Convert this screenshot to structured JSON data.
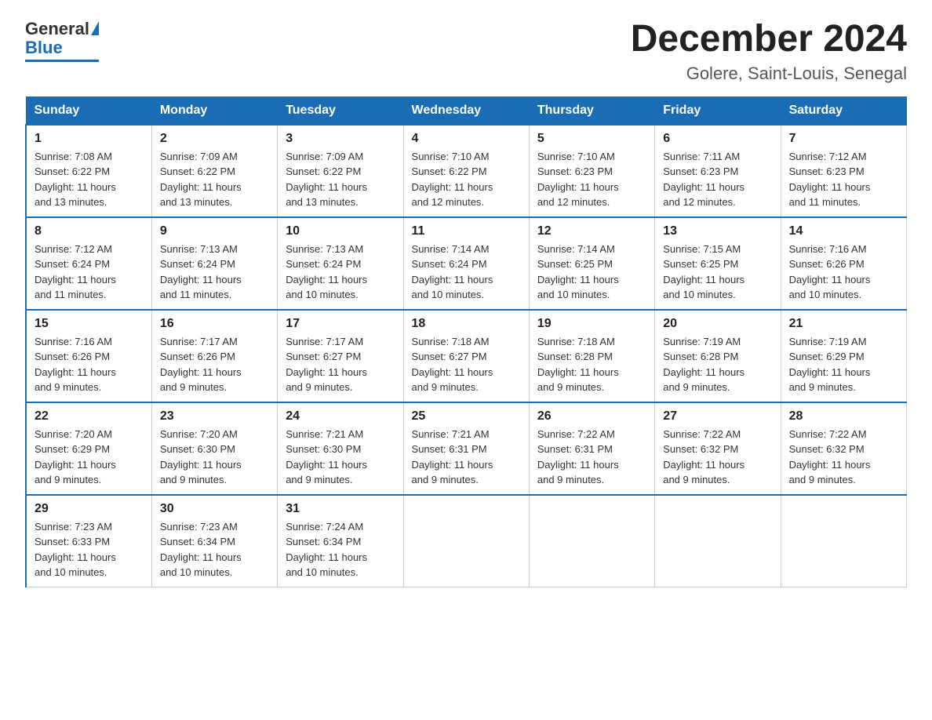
{
  "header": {
    "logo": {
      "general": "General",
      "blue": "Blue"
    },
    "title": "December 2024",
    "location": "Golere, Saint-Louis, Senegal"
  },
  "days_of_week": [
    "Sunday",
    "Monday",
    "Tuesday",
    "Wednesday",
    "Thursday",
    "Friday",
    "Saturday"
  ],
  "weeks": [
    [
      {
        "day": "1",
        "sunrise": "7:08 AM",
        "sunset": "6:22 PM",
        "daylight": "11 hours and 13 minutes."
      },
      {
        "day": "2",
        "sunrise": "7:09 AM",
        "sunset": "6:22 PM",
        "daylight": "11 hours and 13 minutes."
      },
      {
        "day": "3",
        "sunrise": "7:09 AM",
        "sunset": "6:22 PM",
        "daylight": "11 hours and 13 minutes."
      },
      {
        "day": "4",
        "sunrise": "7:10 AM",
        "sunset": "6:22 PM",
        "daylight": "11 hours and 12 minutes."
      },
      {
        "day": "5",
        "sunrise": "7:10 AM",
        "sunset": "6:23 PM",
        "daylight": "11 hours and 12 minutes."
      },
      {
        "day": "6",
        "sunrise": "7:11 AM",
        "sunset": "6:23 PM",
        "daylight": "11 hours and 12 minutes."
      },
      {
        "day": "7",
        "sunrise": "7:12 AM",
        "sunset": "6:23 PM",
        "daylight": "11 hours and 11 minutes."
      }
    ],
    [
      {
        "day": "8",
        "sunrise": "7:12 AM",
        "sunset": "6:24 PM",
        "daylight": "11 hours and 11 minutes."
      },
      {
        "day": "9",
        "sunrise": "7:13 AM",
        "sunset": "6:24 PM",
        "daylight": "11 hours and 11 minutes."
      },
      {
        "day": "10",
        "sunrise": "7:13 AM",
        "sunset": "6:24 PM",
        "daylight": "11 hours and 10 minutes."
      },
      {
        "day": "11",
        "sunrise": "7:14 AM",
        "sunset": "6:24 PM",
        "daylight": "11 hours and 10 minutes."
      },
      {
        "day": "12",
        "sunrise": "7:14 AM",
        "sunset": "6:25 PM",
        "daylight": "11 hours and 10 minutes."
      },
      {
        "day": "13",
        "sunrise": "7:15 AM",
        "sunset": "6:25 PM",
        "daylight": "11 hours and 10 minutes."
      },
      {
        "day": "14",
        "sunrise": "7:16 AM",
        "sunset": "6:26 PM",
        "daylight": "11 hours and 10 minutes."
      }
    ],
    [
      {
        "day": "15",
        "sunrise": "7:16 AM",
        "sunset": "6:26 PM",
        "daylight": "11 hours and 9 minutes."
      },
      {
        "day": "16",
        "sunrise": "7:17 AM",
        "sunset": "6:26 PM",
        "daylight": "11 hours and 9 minutes."
      },
      {
        "day": "17",
        "sunrise": "7:17 AM",
        "sunset": "6:27 PM",
        "daylight": "11 hours and 9 minutes."
      },
      {
        "day": "18",
        "sunrise": "7:18 AM",
        "sunset": "6:27 PM",
        "daylight": "11 hours and 9 minutes."
      },
      {
        "day": "19",
        "sunrise": "7:18 AM",
        "sunset": "6:28 PM",
        "daylight": "11 hours and 9 minutes."
      },
      {
        "day": "20",
        "sunrise": "7:19 AM",
        "sunset": "6:28 PM",
        "daylight": "11 hours and 9 minutes."
      },
      {
        "day": "21",
        "sunrise": "7:19 AM",
        "sunset": "6:29 PM",
        "daylight": "11 hours and 9 minutes."
      }
    ],
    [
      {
        "day": "22",
        "sunrise": "7:20 AM",
        "sunset": "6:29 PM",
        "daylight": "11 hours and 9 minutes."
      },
      {
        "day": "23",
        "sunrise": "7:20 AM",
        "sunset": "6:30 PM",
        "daylight": "11 hours and 9 minutes."
      },
      {
        "day": "24",
        "sunrise": "7:21 AM",
        "sunset": "6:30 PM",
        "daylight": "11 hours and 9 minutes."
      },
      {
        "day": "25",
        "sunrise": "7:21 AM",
        "sunset": "6:31 PM",
        "daylight": "11 hours and 9 minutes."
      },
      {
        "day": "26",
        "sunrise": "7:22 AM",
        "sunset": "6:31 PM",
        "daylight": "11 hours and 9 minutes."
      },
      {
        "day": "27",
        "sunrise": "7:22 AM",
        "sunset": "6:32 PM",
        "daylight": "11 hours and 9 minutes."
      },
      {
        "day": "28",
        "sunrise": "7:22 AM",
        "sunset": "6:32 PM",
        "daylight": "11 hours and 9 minutes."
      }
    ],
    [
      {
        "day": "29",
        "sunrise": "7:23 AM",
        "sunset": "6:33 PM",
        "daylight": "11 hours and 10 minutes."
      },
      {
        "day": "30",
        "sunrise": "7:23 AM",
        "sunset": "6:34 PM",
        "daylight": "11 hours and 10 minutes."
      },
      {
        "day": "31",
        "sunrise": "7:24 AM",
        "sunset": "6:34 PM",
        "daylight": "11 hours and 10 minutes."
      },
      null,
      null,
      null,
      null
    ]
  ],
  "labels": {
    "sunrise": "Sunrise:",
    "sunset": "Sunset:",
    "daylight": "Daylight:"
  }
}
